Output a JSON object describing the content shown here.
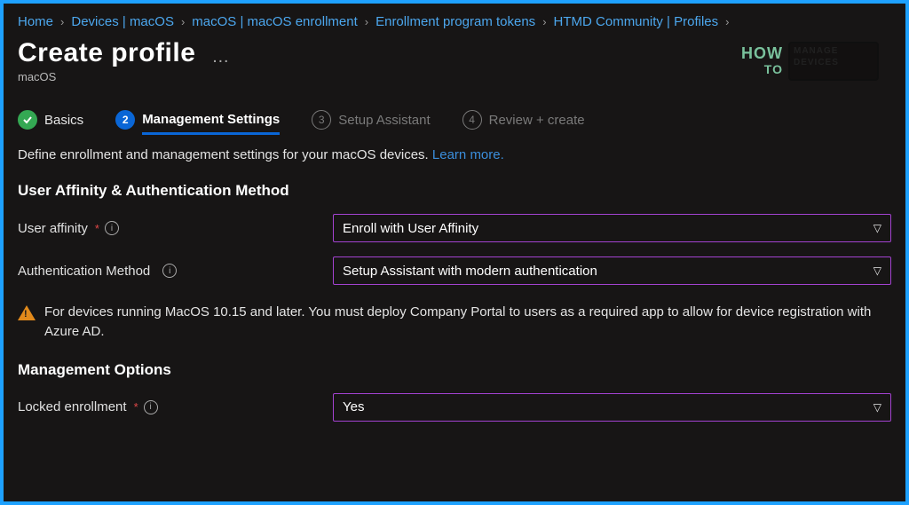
{
  "breadcrumbs": [
    "Home",
    "Devices | macOS",
    "macOS | macOS enrollment",
    "Enrollment program tokens",
    "HTMD Community | Profiles"
  ],
  "header": {
    "title": "Create profile",
    "subtitle": "macOS"
  },
  "watermark": {
    "line1": "HOW",
    "line2": "TO",
    "box1": "MANAGE",
    "box2": "DEVICES"
  },
  "steps": {
    "s1": {
      "num": "✓",
      "label": "Basics"
    },
    "s2": {
      "num": "2",
      "label": "Management Settings"
    },
    "s3": {
      "num": "3",
      "label": "Setup Assistant"
    },
    "s4": {
      "num": "4",
      "label": "Review + create"
    }
  },
  "description": {
    "text": "Define enrollment and management settings for your macOS devices. ",
    "link": "Learn more."
  },
  "section1": {
    "heading": "User Affinity & Authentication Method",
    "userAffinity": {
      "label": "User affinity",
      "value": "Enroll with User Affinity"
    },
    "authMethod": {
      "label": "Authentication Method",
      "value": "Setup Assistant with modern authentication"
    }
  },
  "warning": "For devices running MacOS 10.15 and later. You must deploy Company Portal to users as a required app to allow for device registration with Azure AD.",
  "section2": {
    "heading": "Management Options",
    "lockedEnrollment": {
      "label": "Locked enrollment",
      "value": "Yes"
    }
  }
}
